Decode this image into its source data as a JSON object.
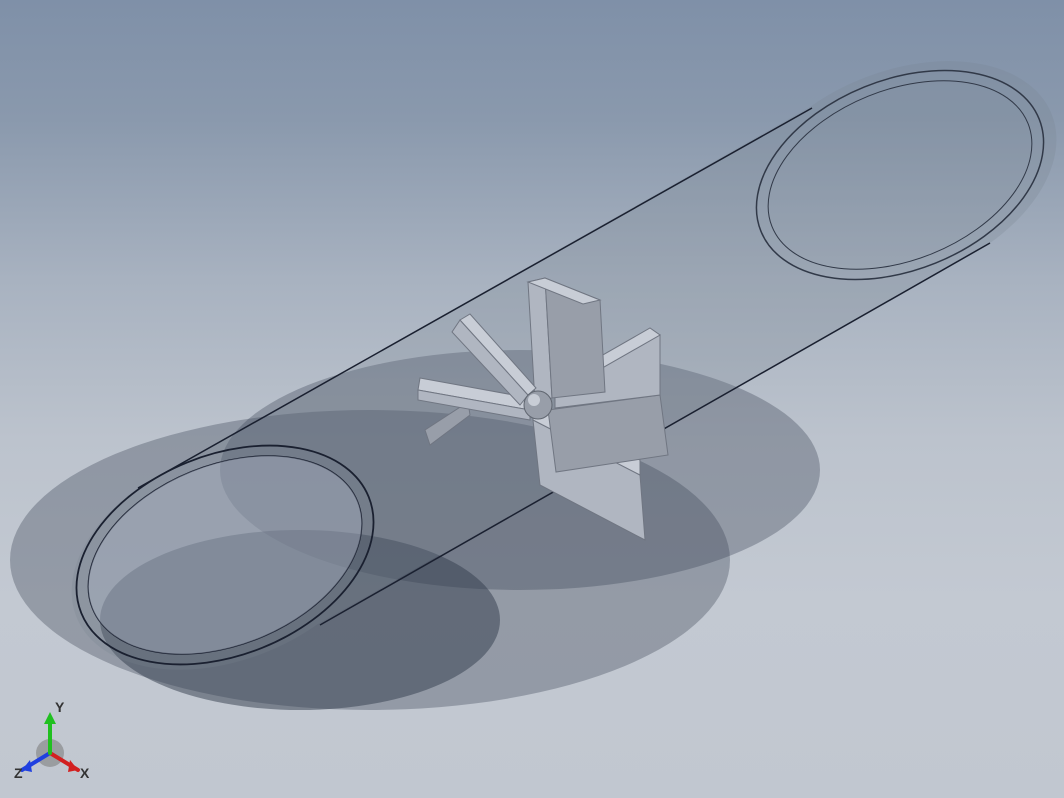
{
  "triad": {
    "x_label": "X",
    "y_label": "Y",
    "z_label": "Z",
    "x_color": "#d22020",
    "y_color": "#20c020",
    "z_color": "#2040e0",
    "center_color": "#808080"
  },
  "model": {
    "cylinder_stroke": "#1a2030",
    "cylinder_fill_front": "rgba(180,190,205,0.35)",
    "cylinder_fill_back": "rgba(120,130,145,0.25)",
    "turbine_face_light": "#c8cdd6",
    "turbine_face_mid": "#b0b6c1",
    "turbine_face_dark": "#989ea9",
    "turbine_edge": "#707682",
    "shadow_color": "rgba(60,70,85,0.35)",
    "shadow_color_dark": "rgba(50,60,75,0.5)"
  }
}
